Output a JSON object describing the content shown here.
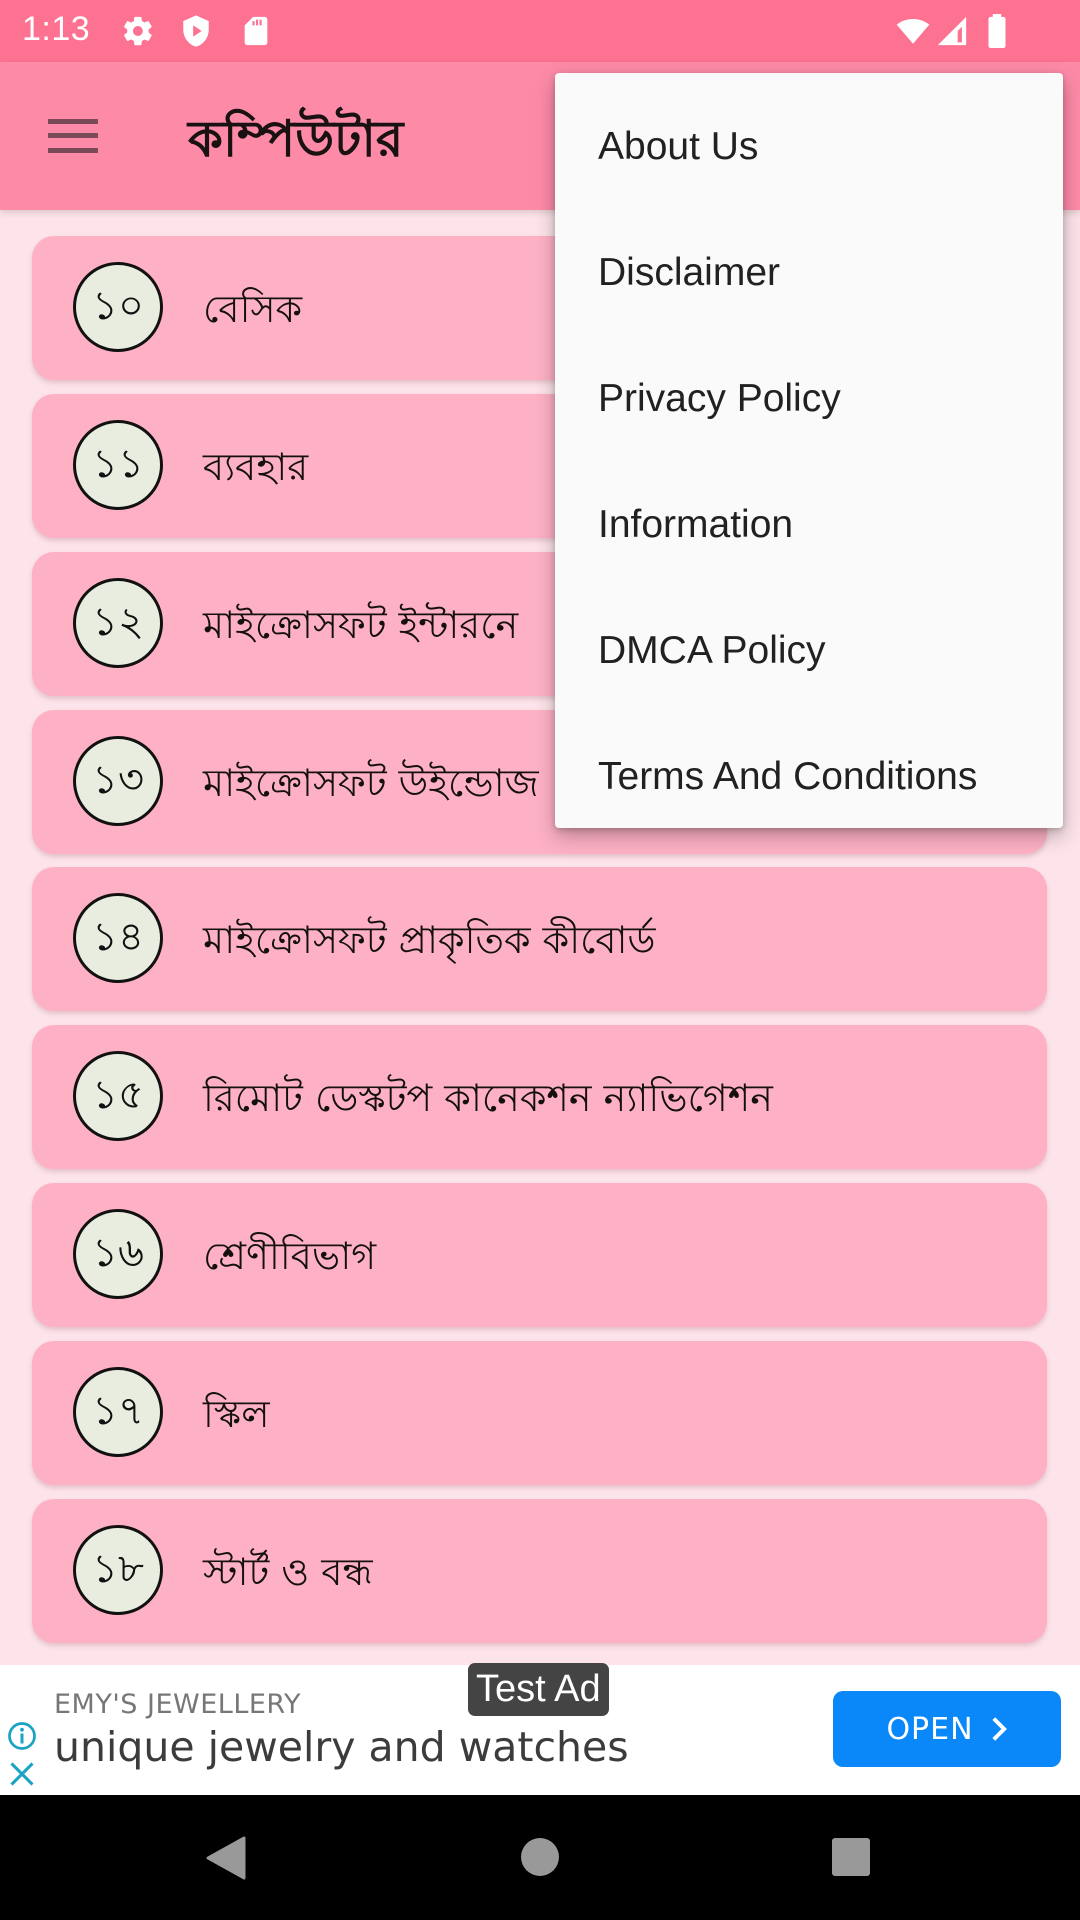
{
  "status_bar": {
    "time": "1:13",
    "left_icons": [
      "gear-icon",
      "shield-play-icon",
      "sd-card-icon"
    ],
    "right_icons": [
      "wifi-icon",
      "signal-icon",
      "battery-icon"
    ]
  },
  "app_bar": {
    "title": "কম্পিউটার",
    "menu_icon": "hamburger-icon"
  },
  "list": {
    "items": [
      {
        "number": "১০",
        "label": "বেসিক"
      },
      {
        "number": "১১",
        "label": "ব্যবহার"
      },
      {
        "number": "১২",
        "label": "মাইক্রোসফট ইন্টারনে"
      },
      {
        "number": "১৩",
        "label": "মাইক্রোসফট উইন্ডোজ"
      },
      {
        "number": "১৪",
        "label": "মাইক্রোসফট প্রাকৃতিক কীবোর্ড"
      },
      {
        "number": "১৫",
        "label": "রিমোট ডেস্কটপ কানেকশন ন্যাভিগেশন"
      },
      {
        "number": "১৬",
        "label": "শ্রেণীবিভাগ"
      },
      {
        "number": "১৭",
        "label": "স্কিল"
      },
      {
        "number": "১৮",
        "label": "স্টার্ট ও বন্ধ"
      }
    ]
  },
  "overflow_menu": {
    "items": [
      {
        "label": "About Us"
      },
      {
        "label": "Disclaimer"
      },
      {
        "label": "Privacy Policy"
      },
      {
        "label": "Information"
      },
      {
        "label": "DMCA Policy"
      },
      {
        "label": "Terms And Conditions"
      }
    ]
  },
  "ad": {
    "badge": "Test Ad",
    "brand": "EMY'S JEWELLERY",
    "headline": "unique jewelry and watches",
    "cta": "OPEN",
    "cta_color": "#0a88f9",
    "icon_color": "#1ba3c6"
  },
  "nav_bar": {
    "buttons": [
      "back-icon",
      "home-icon",
      "recents-icon"
    ]
  },
  "colors": {
    "status_bar": "#fd7191",
    "app_bar": "#fd8ba8",
    "card": "#feb1c5",
    "background": "#fde4ea",
    "badge_fill": "#e9ede0"
  }
}
